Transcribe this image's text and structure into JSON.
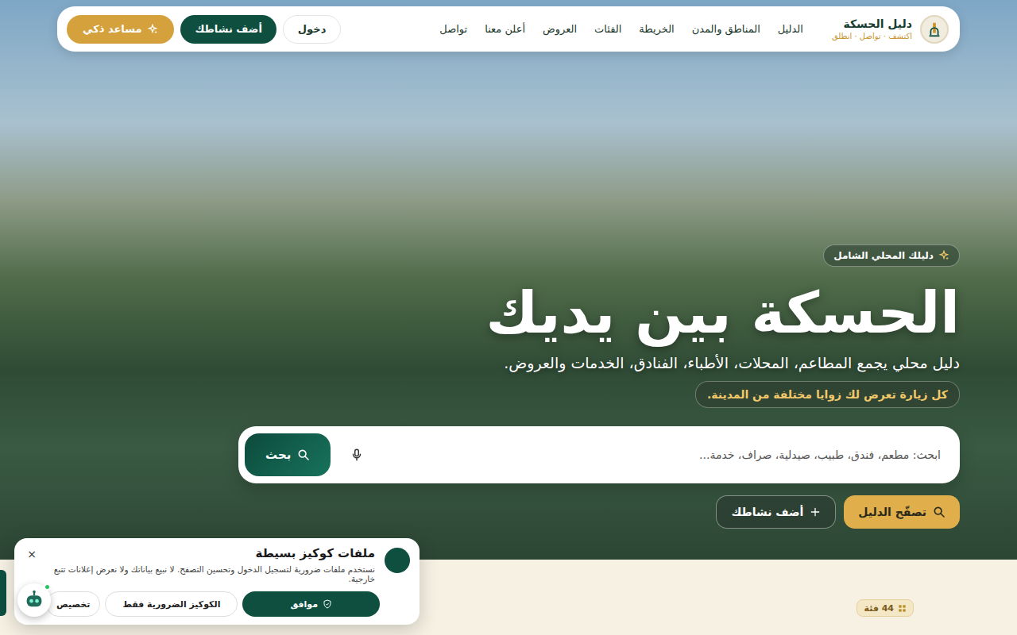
{
  "brand": {
    "name": "دليل الحسكة",
    "tagline": "اكتشف · تواصل · انطلق"
  },
  "nav": {
    "links": [
      {
        "label": "الدليل",
        "selected": false
      },
      {
        "label": "المناطق والمدن",
        "selected": false
      },
      {
        "label": "الخريطة",
        "selected": false
      },
      {
        "label": "الفئات",
        "selected": false
      },
      {
        "label": "العروض",
        "selected": false
      },
      {
        "label": "أعلن معنا",
        "selected": false
      },
      {
        "label": "تواصل",
        "selected": false
      }
    ],
    "login": "دخول",
    "add": "أضف نشاطك",
    "assistant": "مساعد ذكي"
  },
  "hero": {
    "badge": "دليلك المحلي الشامل",
    "title": "الحسكة بين يديك",
    "subtitle": "دليل محلي يجمع المطاعم، المحلات، الأطباء، الفنادق، الخدمات والعروض.",
    "note": "كل زيارة تعرض لك زوايا مختلفة من المدينة."
  },
  "search": {
    "placeholder": "ابحث: مطعم، فندق، طبيب، صيدلية، صراف، خدمة...",
    "button": "بحث"
  },
  "actions": [
    {
      "label": "تصفّح الدليل",
      "kind": "primary"
    },
    {
      "label": "أضف نشاطك",
      "kind": "outline"
    }
  ],
  "section": {
    "badge": "44 فئة"
  },
  "cookie": {
    "title": "ملفات كوكيز بسيطة",
    "text": "نستخدم ملفات ضرورية لتسجيل الدخول وتحسين التصفح. لا نبيع بياناتك ولا نعرض إعلانات تتبع خارجية.",
    "close": "×",
    "buttons": [
      {
        "label": "موافق",
        "kind": "primary"
      },
      {
        "label": "الكوكيز الضرورية فقط",
        "kind": "secondary"
      },
      {
        "label": "تخصيص",
        "kind": "tertiary"
      }
    ]
  }
}
